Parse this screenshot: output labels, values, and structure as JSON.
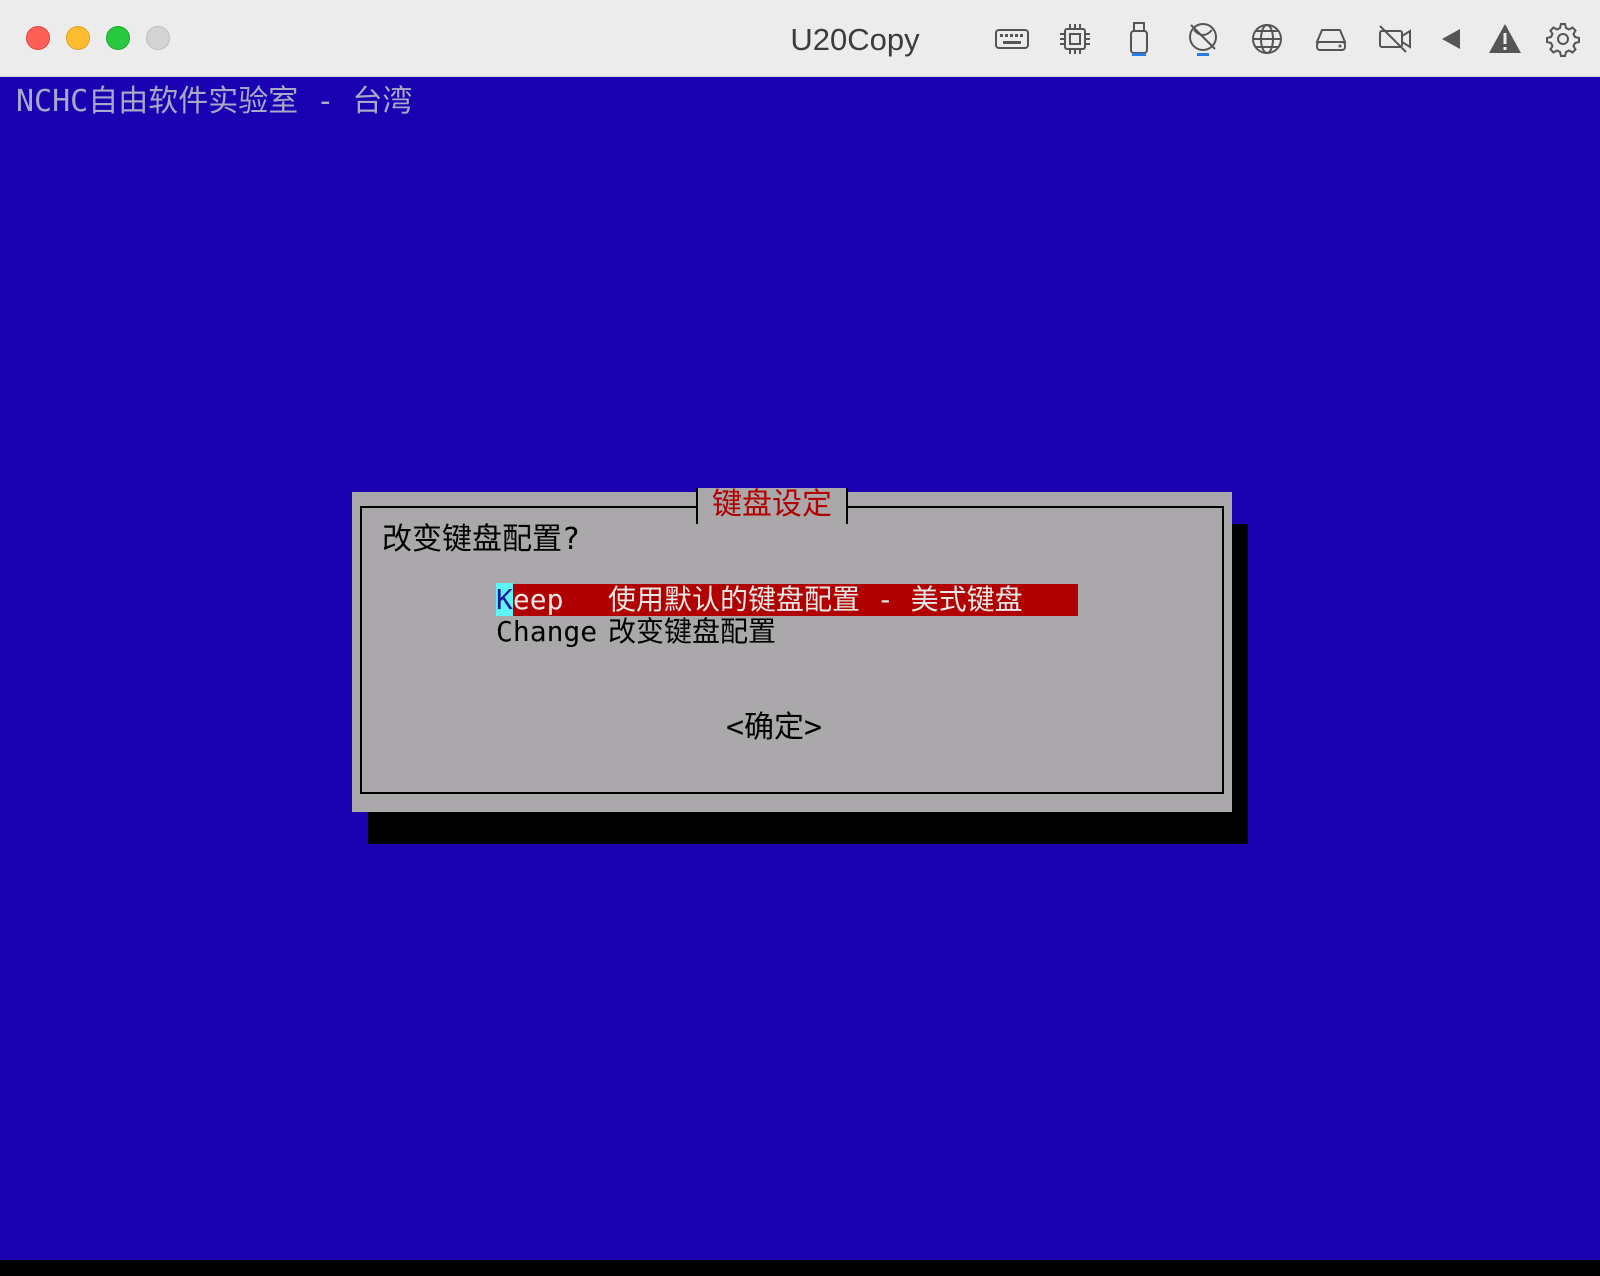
{
  "window": {
    "title": "U20Copy",
    "icons": [
      "keyboard-icon",
      "cpu-icon",
      "usb-icon",
      "network-disabled-icon",
      "globe-icon",
      "drive-icon",
      "camera-off-icon",
      "audio-icon",
      "warning-icon",
      "gear-icon"
    ]
  },
  "console": {
    "header": "NCHC自由软件实验室 - 台湾"
  },
  "dialog": {
    "title": "键盘设定",
    "question": "改变键盘配置?",
    "options": [
      {
        "tag_hot": "K",
        "tag_rest": "eep",
        "description": "使用默认的键盘配置 - 美式键盘",
        "selected": true
      },
      {
        "tag_hot": "",
        "tag_rest": "Change",
        "description": "改变键盘配置",
        "selected": false
      }
    ],
    "ok_label": "<确定>"
  },
  "colors": {
    "background": "#1a00b0",
    "dialog": "#aaa8aa",
    "title": "#b00000",
    "selection": "#b00000",
    "hotkey": "#5ff5f5"
  }
}
